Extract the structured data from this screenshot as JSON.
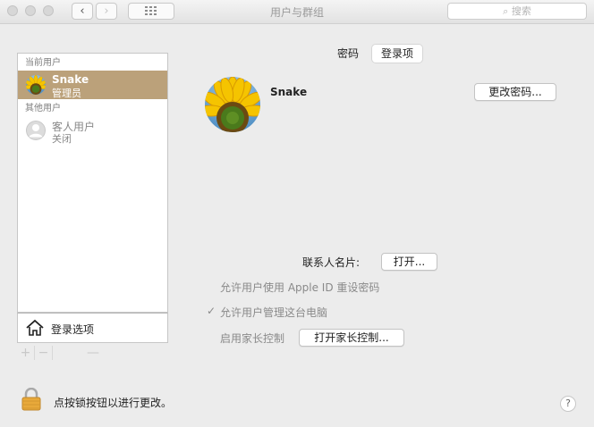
{
  "window": {
    "title": "用户与群组",
    "search_placeholder": "搜索"
  },
  "sidebar": {
    "current_section": "当前用户",
    "current_user": {
      "name": "Snake",
      "role": "管理员"
    },
    "other_section": "其他用户",
    "guest_user": {
      "name": "客人用户",
      "status": "关闭"
    },
    "login_options": "登录选项",
    "add": "+",
    "remove": "−",
    "more": "—"
  },
  "tabs": {
    "password": "密码",
    "login_items": "登录项"
  },
  "user": {
    "name": "Snake",
    "change_password": "更改密码..."
  },
  "contact": {
    "label": "联系人名片:",
    "open": "打开..."
  },
  "options": {
    "apple_id_reset": "允许用户使用 Apple ID 重设密码",
    "check": "✓",
    "allow_admin": "允许用户管理这台电脑",
    "parental_label": "启用家长控制",
    "parental_button": "打开家长控制..."
  },
  "footer": {
    "lock_text": "点按锁按钮以进行更改。",
    "help": "?"
  },
  "colors": {
    "selection": "#bba17a",
    "window_bg": "#ececec"
  }
}
